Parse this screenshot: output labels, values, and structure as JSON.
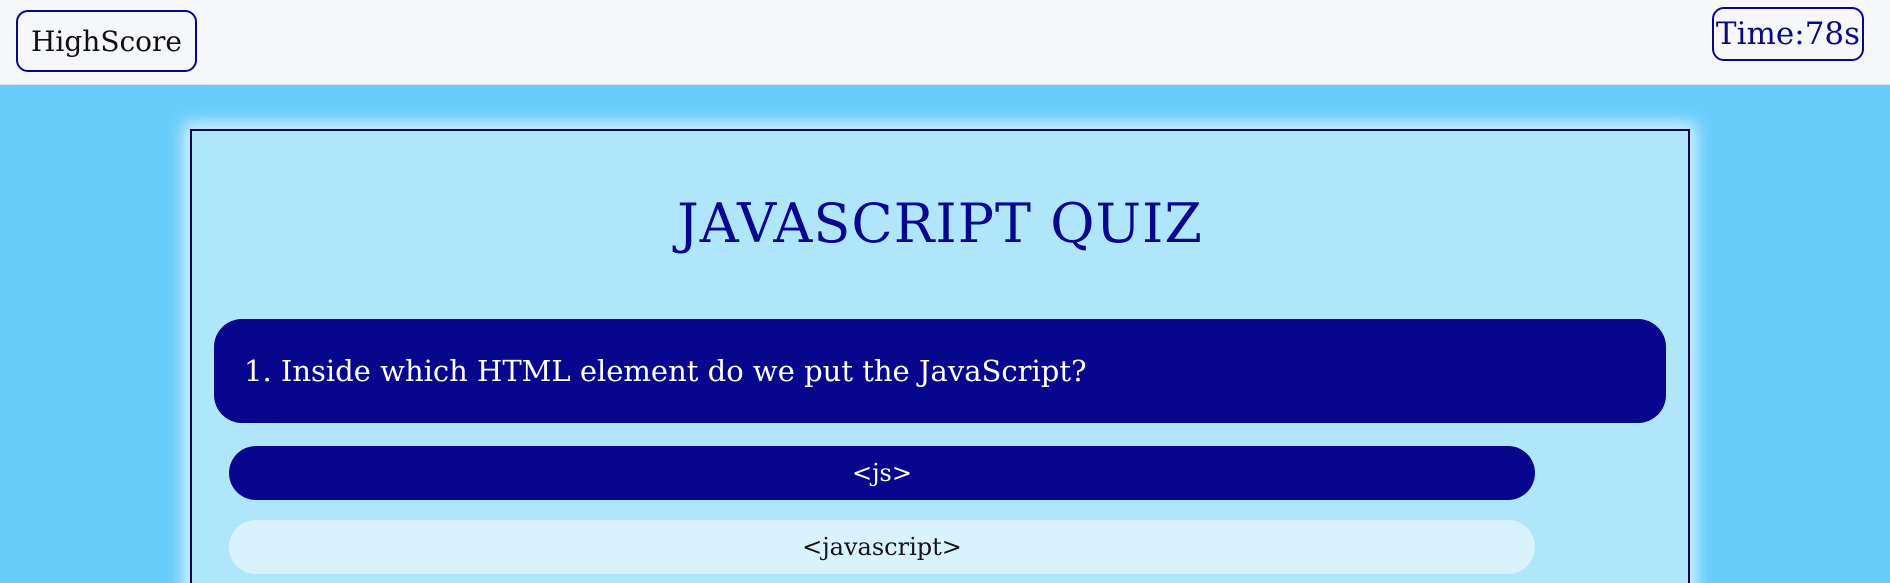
{
  "header": {
    "highscore_label": "HighScore",
    "timer_text": "Time:78s"
  },
  "quiz": {
    "title": "JAVASCRIPT QUIZ",
    "question": "1. Inside which HTML element do we put the JavaScript?",
    "options": [
      {
        "label": "<js>",
        "state": "selected"
      },
      {
        "label": "<javascript>",
        "state": "default"
      }
    ]
  },
  "colors": {
    "page_background": "#67ccfb",
    "header_background": "#f6f7fa",
    "card_background": "#b0e6fc",
    "accent": "#07078e",
    "option_default_background": "#d8f3fe"
  }
}
